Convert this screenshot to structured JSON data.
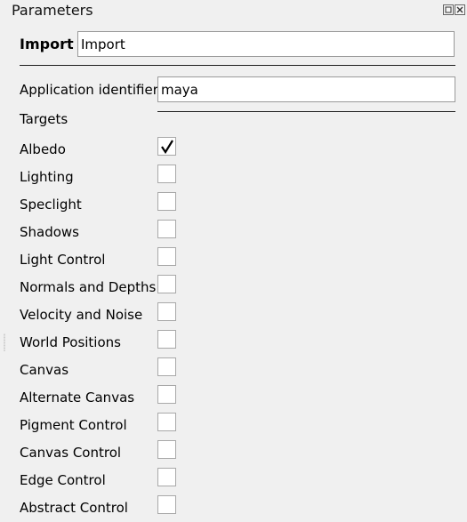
{
  "panel": {
    "title": "Parameters",
    "float_icon": "float-icon",
    "close_icon": "close-icon"
  },
  "import": {
    "label": "Import",
    "value": "Import"
  },
  "application": {
    "label": "Application identifier",
    "value": "maya"
  },
  "targets": {
    "heading": "Targets",
    "items": [
      {
        "label": "Albedo",
        "checked": true
      },
      {
        "label": "Lighting",
        "checked": false
      },
      {
        "label": "Speclight",
        "checked": false
      },
      {
        "label": "Shadows",
        "checked": false
      },
      {
        "label": "Light Control",
        "checked": false
      },
      {
        "label": "Normals and Depths",
        "checked": false
      },
      {
        "label": "Velocity and Noise",
        "checked": false
      },
      {
        "label": "World Positions",
        "checked": false
      },
      {
        "label": "Canvas",
        "checked": false
      },
      {
        "label": "Alternate Canvas",
        "checked": false
      },
      {
        "label": "Pigment Control",
        "checked": false
      },
      {
        "label": "Canvas Control",
        "checked": false
      },
      {
        "label": "Edge Control",
        "checked": false
      },
      {
        "label": "Abstract Control",
        "checked": false
      }
    ]
  },
  "colors": {
    "background": "#f0f0f0",
    "input_border": "#9a9a9a",
    "separator": "#202020"
  }
}
